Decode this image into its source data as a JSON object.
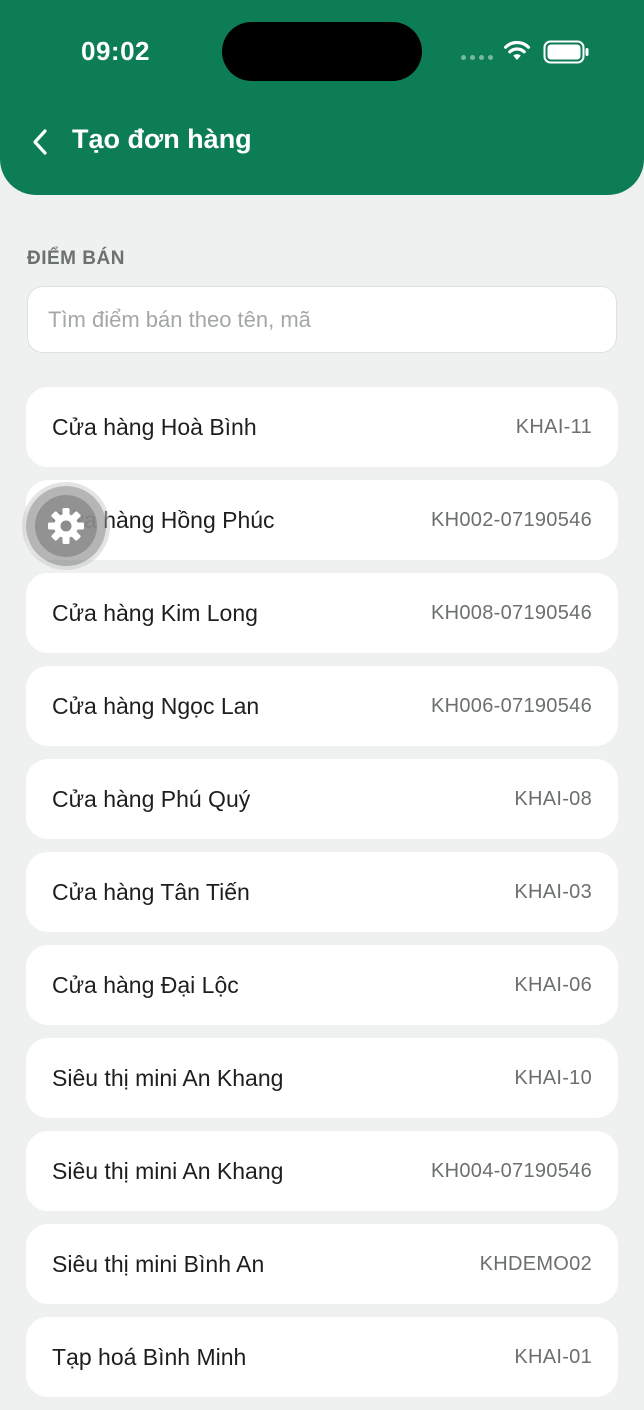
{
  "status_bar": {
    "time": "09:02"
  },
  "header": {
    "title": "Tạo đơn hàng",
    "back_icon": "chevron-left-icon"
  },
  "colors": {
    "brand": "#0d7d55",
    "background": "#eef1f0",
    "card": "#ffffff"
  },
  "section": {
    "label": "ĐIỂM BÁN"
  },
  "search": {
    "placeholder": "Tìm điểm bán theo tên, mã",
    "value": ""
  },
  "stores": [
    {
      "name": "Cửa hàng Hoà Bình",
      "code": "KHAI-11"
    },
    {
      "name": "Cửa hàng Hồng Phúc",
      "code": "KH002-07190546"
    },
    {
      "name": "Cửa hàng Kim Long",
      "code": "KH008-07190546"
    },
    {
      "name": "Cửa hàng Ngọc Lan",
      "code": "KH006-07190546"
    },
    {
      "name": "Cửa hàng Phú Quý",
      "code": "KHAI-08"
    },
    {
      "name": "Cửa hàng Tân Tiến",
      "code": "KHAI-03"
    },
    {
      "name": "Cửa hàng Đại Lộc",
      "code": "KHAI-06"
    },
    {
      "name": "Siêu thị mini An Khang",
      "code": "KHAI-10"
    },
    {
      "name": "Siêu thị mini An Khang",
      "code": "KH004-07190546"
    },
    {
      "name": "Siêu thị mini Bình An",
      "code": "KHDEMO02"
    },
    {
      "name": "Tạp hoá Bình Minh",
      "code": "KHAI-01"
    }
  ],
  "floating_button": {
    "icon": "gear-icon"
  }
}
